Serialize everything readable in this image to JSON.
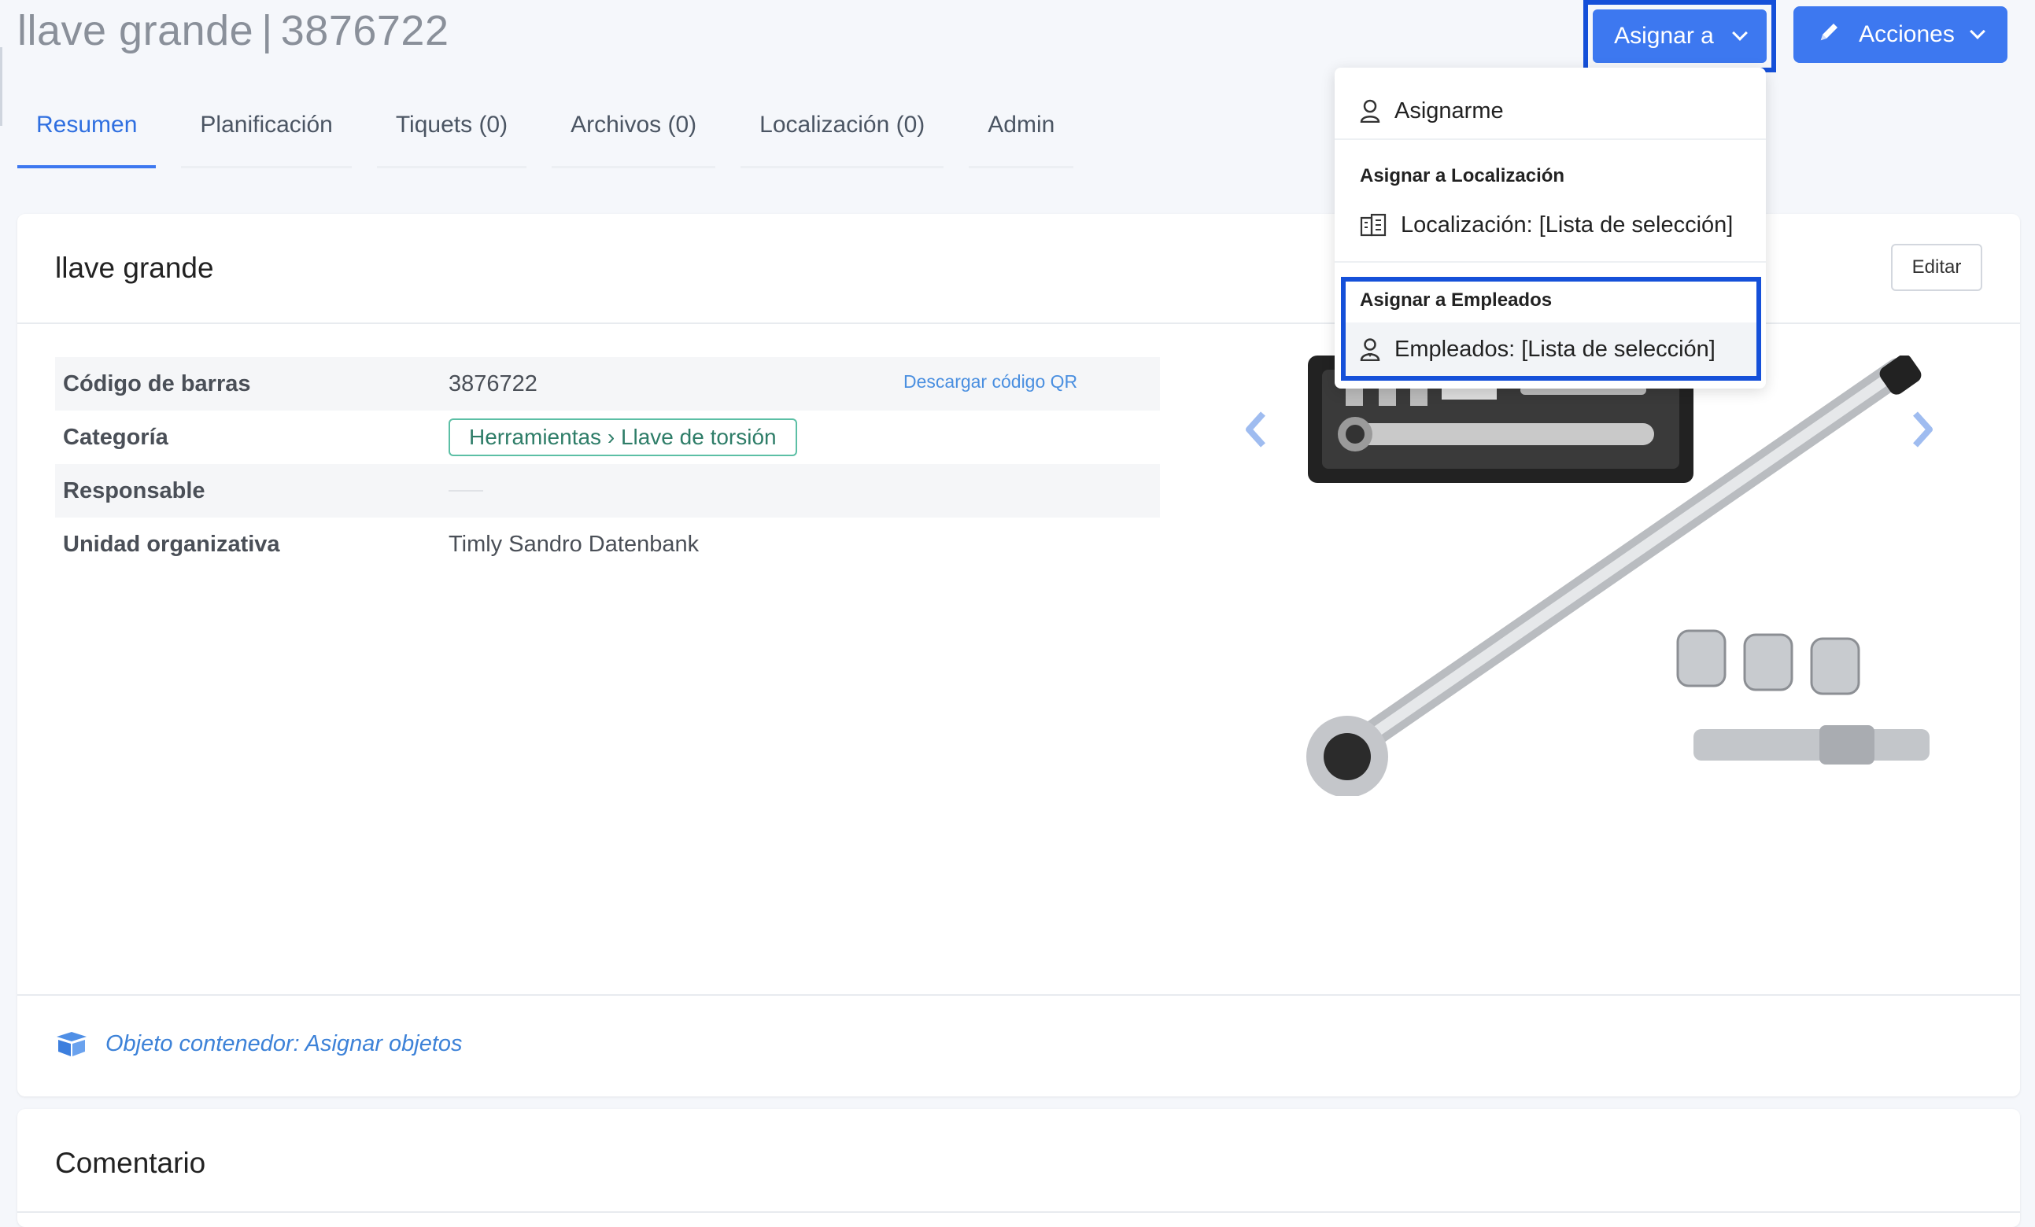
{
  "header": {
    "title_name": "llave grande",
    "title_separator": "|",
    "title_code": "3876722",
    "assign_button": "Asignar a",
    "actions_button": "Acciones"
  },
  "tabs": [
    {
      "label": "Resumen",
      "active": true
    },
    {
      "label": "Planificación"
    },
    {
      "label": "Tiquets (0)"
    },
    {
      "label": "Archivos (0)"
    },
    {
      "label": "Localización (0)"
    },
    {
      "label": "Admin"
    }
  ],
  "card": {
    "title": "llave grande",
    "edit_button": "Editar",
    "fields": [
      {
        "label": "Código de barras",
        "value": "3876722",
        "link": "Descargar código QR"
      },
      {
        "label": "Categoría",
        "value": "Herramientas › Llave de torsión"
      },
      {
        "label": "Responsable",
        "value": ""
      },
      {
        "label": "Unidad organizativa",
        "value": "Timly Sandro Datenbank"
      }
    ],
    "container_text": "Objeto contenedor: Asignar objetos"
  },
  "comment_card": {
    "title": "Comentario"
  },
  "dropdown": {
    "assign_me": "Asignarme",
    "location_heading": "Asignar a Localización",
    "location_item": "Localización: [Lista de selección]",
    "employees_heading": "Asignar a Empleados",
    "employees_item": "Empleados: [Lista de selección]"
  },
  "icons": {
    "user": "user-icon",
    "building": "building-icon",
    "employee": "employee-icon",
    "pencil": "pencil-icon",
    "box": "box-icon"
  },
  "colors": {
    "primary": "#3d78f0",
    "highlight_border": "#1550d9",
    "link": "#4a8fe0",
    "badge_border": "#5cbfa5"
  }
}
